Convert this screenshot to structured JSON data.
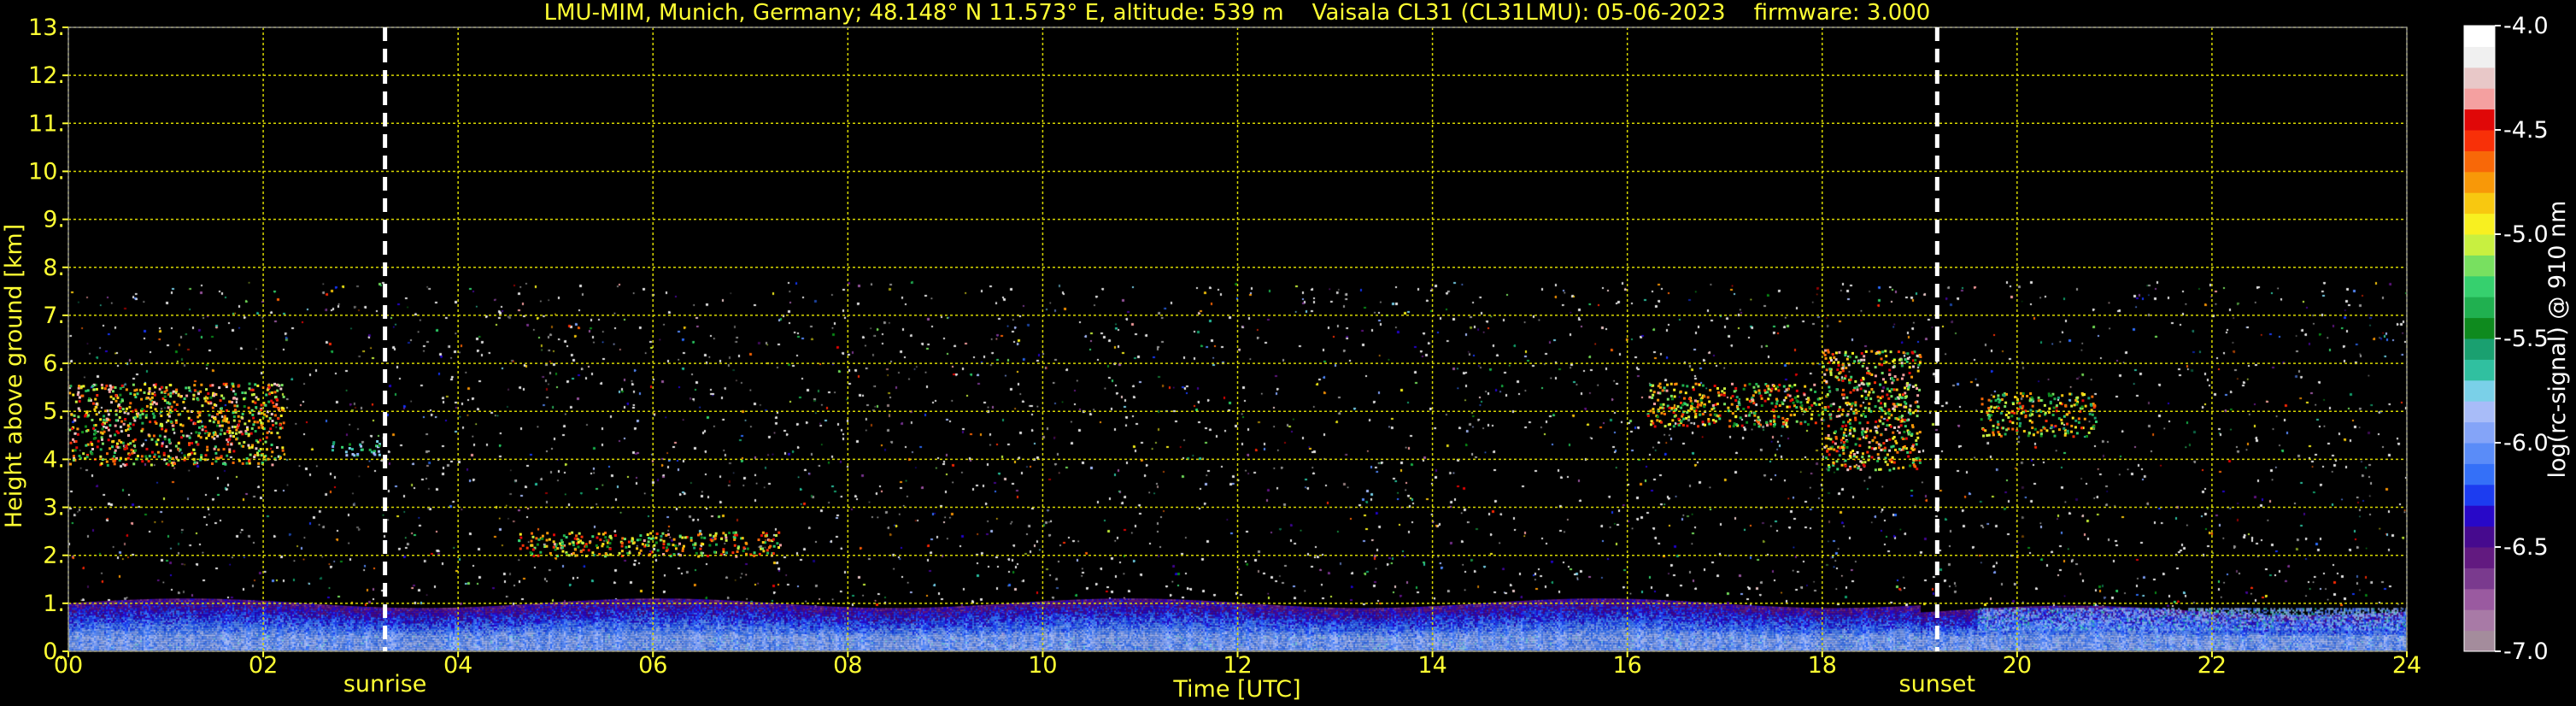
{
  "chart_data": {
    "type": "heatmap",
    "title": "LMU-MIM, Munich, Germany; 48.148° N 11.573° E, altitude: 539 m    Vaisala CL31 (CL31LMU): 05-06-2023    firmware: 3.000",
    "xlabel": "Time [UTC]",
    "ylabel": "Height above ground [km]",
    "xlim": [
      0,
      24
    ],
    "ylim": [
      0,
      13
    ],
    "x_ticks": [
      0,
      2,
      4,
      6,
      8,
      10,
      12,
      14,
      16,
      18,
      20,
      22,
      24
    ],
    "x_tick_labels": [
      "00",
      "02",
      "04",
      "06",
      "08",
      "10",
      "12",
      "14",
      "16",
      "18",
      "20",
      "22",
      "24"
    ],
    "y_ticks": [
      0,
      1,
      2,
      3,
      4,
      5,
      6,
      7,
      8,
      9,
      10,
      11,
      12,
      13
    ],
    "y_tick_labels": [
      "0.",
      "1.",
      "2.",
      "3.",
      "4.",
      "5.",
      "6.",
      "7.",
      "8.",
      "9.",
      "10.",
      "11.",
      "12.",
      "13."
    ],
    "grid": true,
    "data_top_km": 7.7,
    "markers": [
      {
        "label": "sunrise",
        "x": 3.25
      },
      {
        "label": "sunset",
        "x": 19.18
      }
    ],
    "features": [
      {
        "kind": "cloud",
        "x_start": 0.0,
        "x_end": 2.2,
        "y_low": 3.9,
        "y_high": 5.6,
        "intensity": 0.95
      },
      {
        "kind": "cloud",
        "x_start": 2.7,
        "x_end": 3.2,
        "y_low": 4.1,
        "y_high": 4.4,
        "intensity": 0.6
      },
      {
        "kind": "cloud",
        "x_start": 4.6,
        "x_end": 7.3,
        "y_low": 2.0,
        "y_high": 2.5,
        "intensity": 0.9
      },
      {
        "kind": "cloud",
        "x_start": 16.2,
        "x_end": 18.0,
        "y_low": 4.7,
        "y_high": 5.6,
        "intensity": 0.9
      },
      {
        "kind": "cloud",
        "x_start": 18.0,
        "x_end": 19.0,
        "y_low": 3.8,
        "y_high": 6.3,
        "intensity": 0.95
      },
      {
        "kind": "cloud",
        "x_start": 19.6,
        "x_end": 20.8,
        "y_low": 4.5,
        "y_high": 5.4,
        "intensity": 0.85
      }
    ],
    "colorbar": {
      "label": "log(rc-signal) @ 910 nm",
      "min": -7.0,
      "max": -4.0,
      "ticks": [
        -4.0,
        -4.5,
        -5.0,
        -5.5,
        -6.0,
        -6.5,
        -7.0
      ],
      "tick_labels": [
        "-4.0",
        "-4.5",
        "-5.0",
        "-5.5",
        "-6.0",
        "-6.5",
        "-7.0"
      ],
      "colors": [
        "#a48c9c",
        "#a87aa6",
        "#9a5aa0",
        "#7a3a8e",
        "#621a80",
        "#460a8e",
        "#2808c8",
        "#1c3cf0",
        "#3470f8",
        "#5a8cf8",
        "#84a4f8",
        "#a8bcf8",
        "#7ad0e8",
        "#30c0a0",
        "#1aa070",
        "#0e8a1e",
        "#20b050",
        "#36d06e",
        "#78e060",
        "#c8f040",
        "#f8f020",
        "#f8c810",
        "#f89808",
        "#f86808",
        "#f83008",
        "#e00808",
        "#f4a0a0",
        "#e8c8c8",
        "#f0f0f0",
        "#ffffff"
      ]
    }
  }
}
